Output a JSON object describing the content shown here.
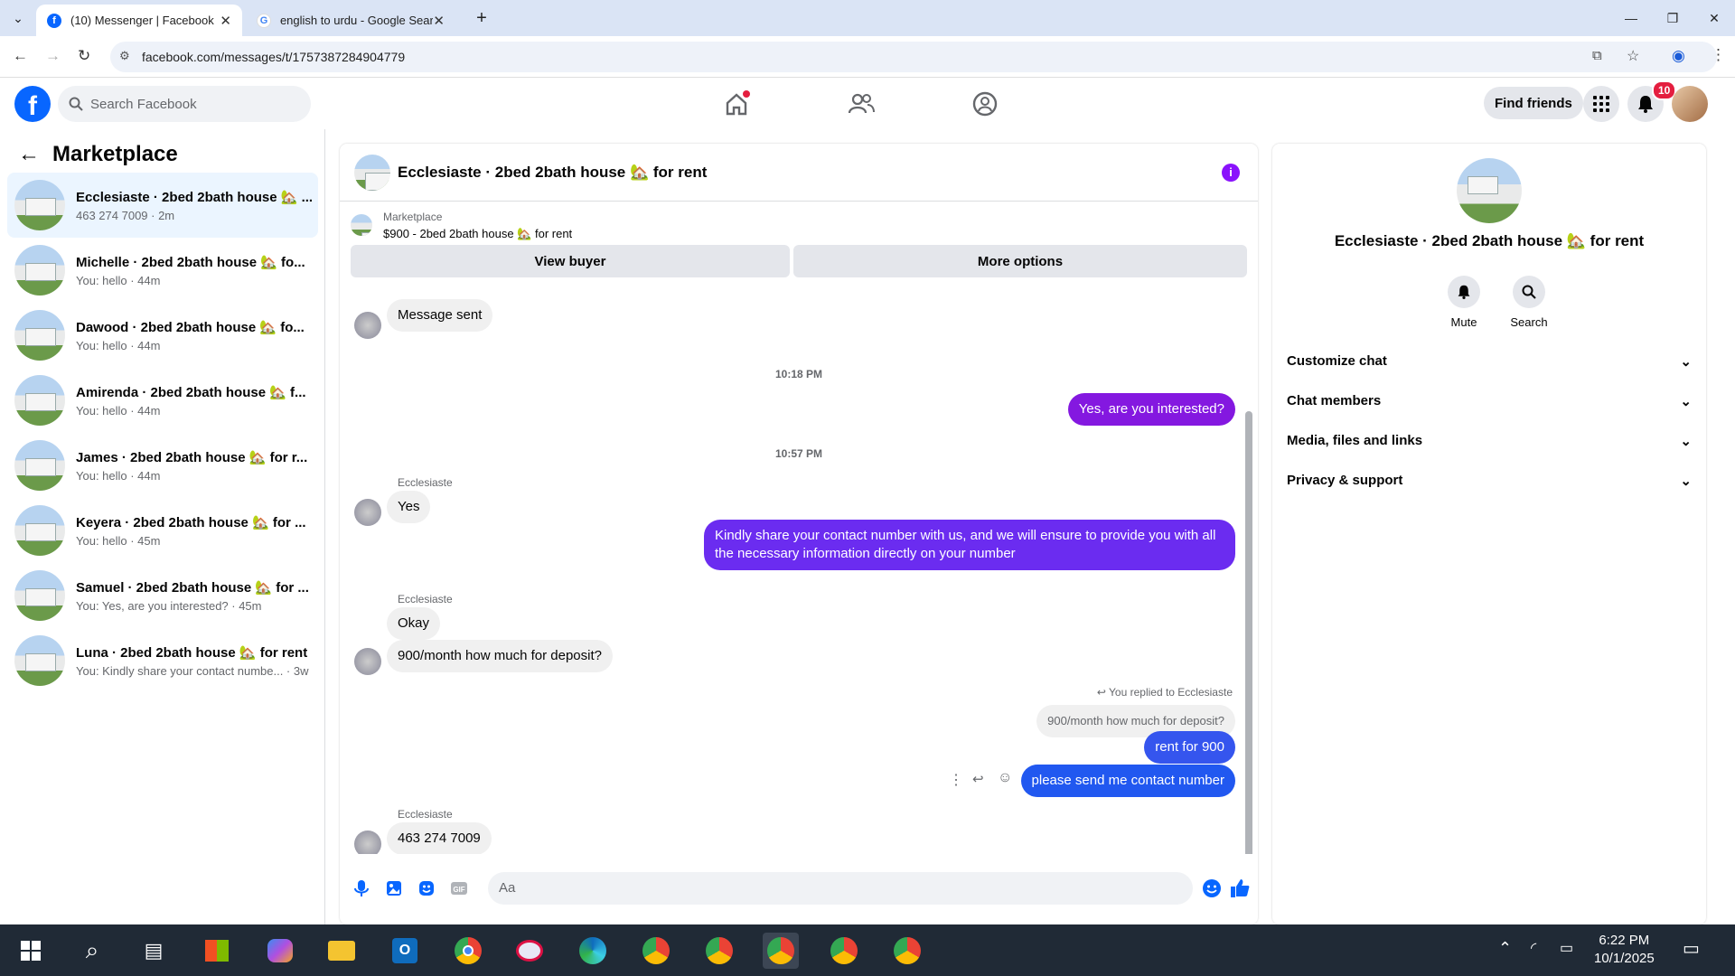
{
  "browser": {
    "tabs": [
      {
        "title": "(10) Messenger | Facebook",
        "active": true
      },
      {
        "title": "english to urdu - Google Search",
        "active": false
      }
    ],
    "url": "facebook.com/messages/t/1757387284904779"
  },
  "header": {
    "search_placeholder": "Search Facebook",
    "find_friends": "Find friends",
    "notifications_badge": "10"
  },
  "sidebar": {
    "title": "Marketplace",
    "conversations": [
      {
        "name": "Ecclesiaste · 2bed 2bath house 🏡 ...",
        "preview": "463 274 7009 · 2m",
        "selected": true
      },
      {
        "name": "Michelle · 2bed 2bath house 🏡 fo...",
        "preview": "You: hello · 44m"
      },
      {
        "name": "Dawood · 2bed 2bath house 🏡 fo...",
        "preview": "You: hello · 44m"
      },
      {
        "name": "Amirenda · 2bed 2bath house 🏡 f...",
        "preview": "You: hello · 44m"
      },
      {
        "name": "James · 2bed 2bath house 🏡 for r...",
        "preview": "You: hello · 44m"
      },
      {
        "name": "Keyera · 2bed 2bath house 🏡 for ...",
        "preview": "You: hello · 45m"
      },
      {
        "name": "Samuel · 2bed 2bath house 🏡 for ...",
        "preview": "You: Yes, are you interested? · 45m"
      },
      {
        "name": "Luna · 2bed 2bath house 🏡 for rent",
        "preview": "You: Kindly share your contact numbe... · 3w"
      }
    ]
  },
  "chat": {
    "title": "Ecclesiaste · 2bed 2bath house 🏡 for rent",
    "marketplace_label": "Marketplace",
    "listing": "$900 - 2bed 2bath house 🏡 for rent",
    "view_buyer": "View buyer",
    "more_options": "More options",
    "messages": {
      "msg_sent": "Message sent",
      "ts1": "10:18 PM",
      "out1": "Yes, are you interested?",
      "ts2": "10:57 PM",
      "sender": "Ecclesiaste",
      "in_yes": "Yes",
      "out2": "Kindly share your contact number with us, and we will ensure to provide you with all the necessary information directly on your number",
      "in_okay": "Okay",
      "in_deposit": "900/month how much for deposit?",
      "replied_label": "You replied to Ecclesiaste",
      "quoted": "900/month how much for deposit?",
      "out3": "rent for 900",
      "out4": "please send me contact number",
      "in_phone": "463 274 7009"
    },
    "composer_placeholder": "Aa"
  },
  "info_panel": {
    "name": "Ecclesiaste · 2bed 2bath house 🏡 for rent",
    "mute": "Mute",
    "search": "Search",
    "sections": [
      "Customize chat",
      "Chat members",
      "Media, files and links",
      "Privacy & support"
    ]
  },
  "taskbar": {
    "time": "6:22 PM",
    "date": "10/1/2025"
  },
  "colors": {
    "fb_blue": "#0866ff",
    "purple_bubble": "#8418e0",
    "blue_bubble": "#2158f0"
  }
}
